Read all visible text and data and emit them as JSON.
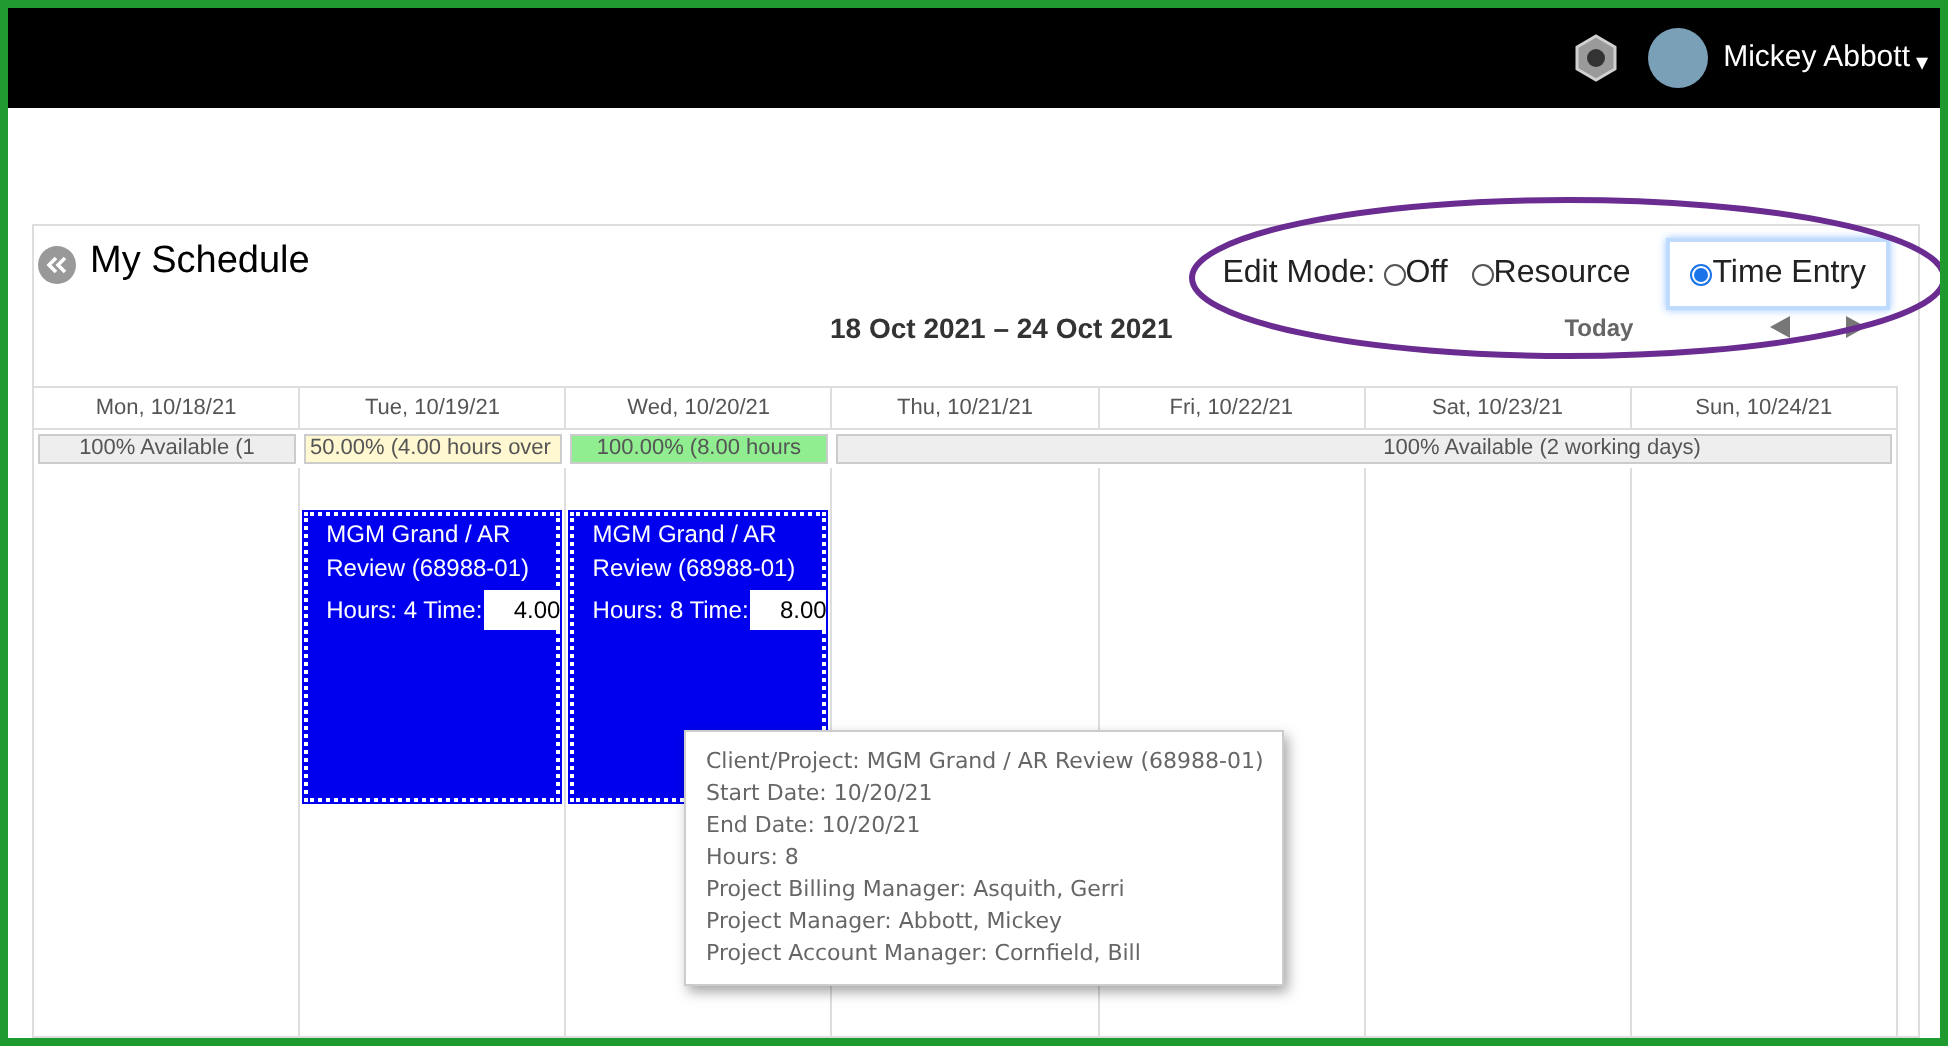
{
  "header": {
    "user_name": "Mickey Abbott",
    "menu_caret": "▾"
  },
  "schedule": {
    "title": "My Schedule",
    "date_range": "18 Oct 2021 – 24 Oct 2021",
    "today_label": "Today"
  },
  "edit_mode": {
    "label": "Edit Mode:",
    "options": [
      {
        "label": "Off",
        "selected": false
      },
      {
        "label": "Resource",
        "selected": false
      },
      {
        "label": "Time Entry",
        "selected": true
      }
    ]
  },
  "days": [
    {
      "header": "Mon, 10/18/21"
    },
    {
      "header": "Tue, 10/19/21",
      "events": [
        {
          "title": "MGM Grand / AR Review (68988-01)",
          "hours_label": "Hours: 4 Time:",
          "time": "4.00"
        }
      ]
    },
    {
      "header": "Wed, 10/20/21",
      "events": [
        {
          "title": "MGM Grand / AR Review (68988-01)",
          "hours_label": "Hours: 8 Time:",
          "time": "8.00"
        }
      ]
    },
    {
      "header": "Thu, 10/21/21"
    },
    {
      "header": "Fri, 10/22/21"
    },
    {
      "header": "Sat, 10/23/21"
    },
    {
      "header": "Sun, 10/24/21"
    }
  ],
  "availability": [
    {
      "kind": "day",
      "text": "100% Available (1",
      "color": "#eeeeee"
    },
    {
      "kind": "day",
      "text": "50.00% (4.00 hours over",
      "color": "#fff8d0"
    },
    {
      "kind": "day",
      "text": "100.00% (8.00 hours",
      "color": "#90ee90"
    },
    {
      "kind": "range",
      "text": "100% Available (2 working days)",
      "color": "#eeeeee"
    }
  ],
  "tooltip": {
    "lines": [
      "Client/Project: MGM Grand / AR Review (68988-01)",
      "Start Date: 10/20/21",
      "End Date: 10/20/21",
      "Hours: 8",
      "Project Billing Manager: Asquith, Gerri",
      "Project Manager: Abbott, Mickey",
      "Project Account Manager: Cornfield, Bill"
    ]
  }
}
